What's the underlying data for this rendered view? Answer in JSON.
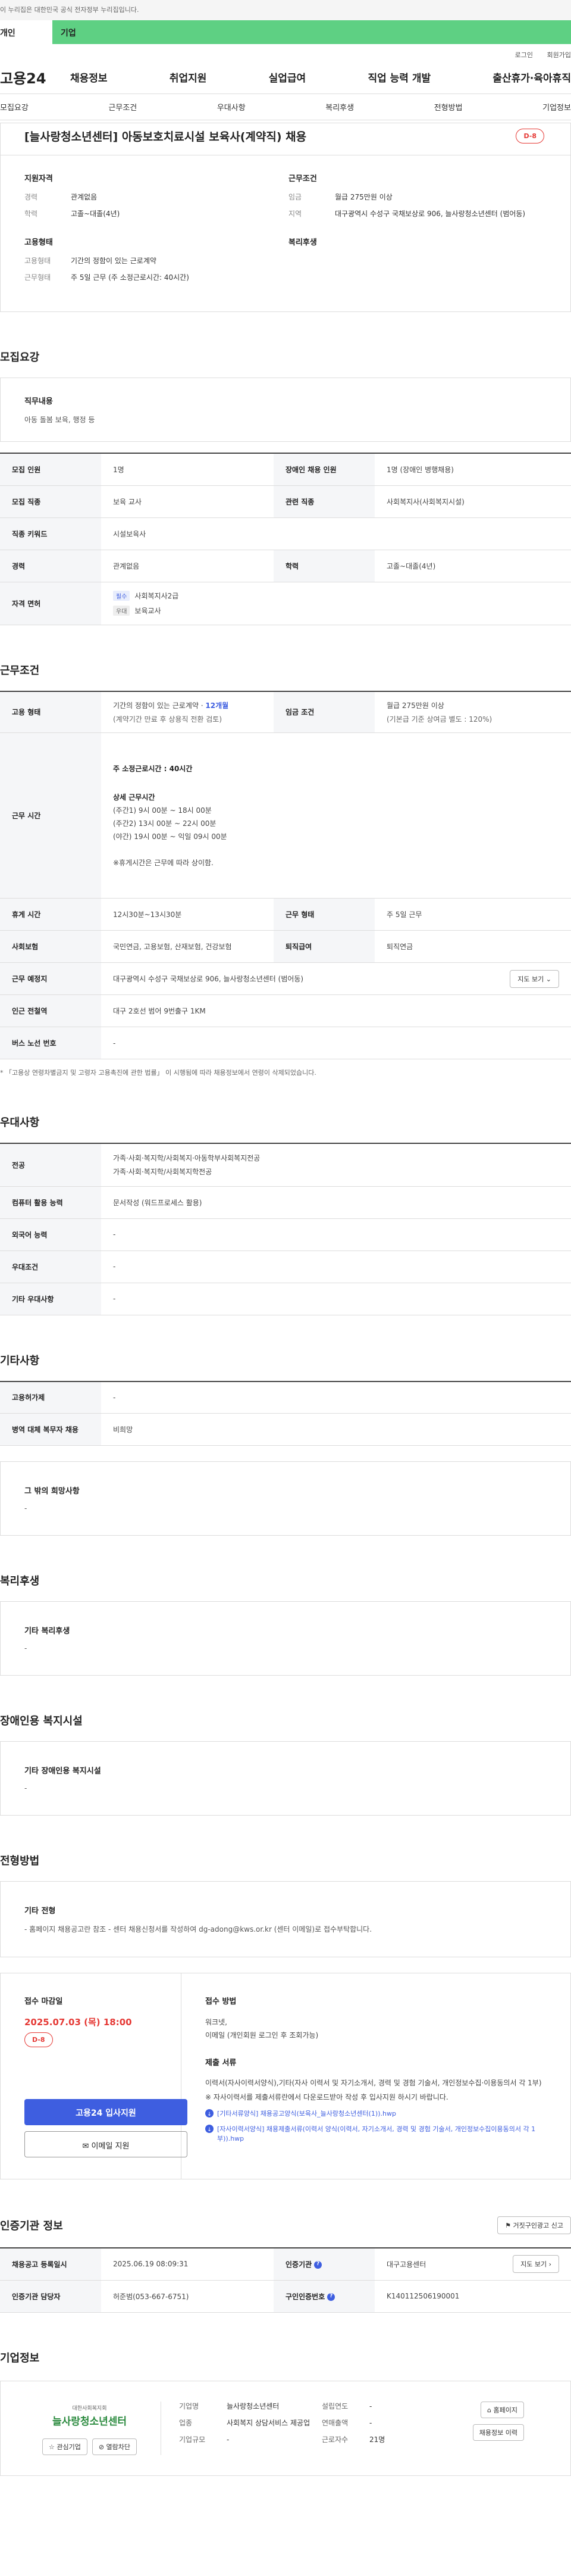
{
  "gov_banner": "이 누리집은 대한민국 공식 전자정부 누리집입니다.",
  "top_tabs": [
    "개인",
    "기업"
  ],
  "util": {
    "login": "로그인",
    "signup": "회원가입"
  },
  "gnb": {
    "logo": "고용24",
    "menu": [
      "채용정보",
      "취업지원",
      "실업급여",
      "직업 능력 개발",
      "출산휴가·육아휴직"
    ]
  },
  "anchor_nav": [
    "모집요강",
    "근무조건",
    "우대사항",
    "복리후생",
    "전형방법",
    "기업정보"
  ],
  "title_card": {
    "title": "[늘사랑청소년센터] 아동보호치료시설 보육사(계약직) 채용",
    "dday": "D-8",
    "req_heading": "지원자격",
    "req": [
      {
        "k": "경력",
        "v": "관계없음"
      },
      {
        "k": "학력",
        "v": "고졸~대졸(4년)"
      }
    ],
    "emp_heading": "고용형태",
    "emp": [
      {
        "k": "고용형태",
        "v": "기간의 정함이 있는 근로계약"
      },
      {
        "k": "근무형태",
        "v": "주 5일 근무 (주 소정근로시간: 40시간)"
      }
    ],
    "cond_heading": "근무조건",
    "cond": [
      {
        "k": "임금",
        "v": "월급 275만원 이상"
      },
      {
        "k": "지역",
        "v": "대구광역시 수성구 국채보상로 906, 늘사랑청소년센터 (범어동)"
      }
    ],
    "welfare_heading": "복리후생"
  },
  "recruit": {
    "heading": "모집요강",
    "duty_label": "직무내용",
    "duty_text": "아동 돌봄 보육, 행정 등",
    "rows": {
      "count_k": "모집 인원",
      "count_v": "1명",
      "disabled_k": "장애인 채용 인원",
      "disabled_v": "1명 (장애인 병행채용)",
      "job_k": "모집 직종",
      "job_v": "보육 교사",
      "related_k": "관련 직종",
      "related_v": "사회복지사(사회복지시설)",
      "keyword_k": "직종 키워드",
      "keyword_v": "시설보육사",
      "career_k": "경력",
      "career_v": "관계없음",
      "edu_k": "학력",
      "edu_v": "고졸~대졸(4년)",
      "license_k": "자격 면허",
      "license": [
        {
          "badge": "필수",
          "name": "사회복지사2급",
          "color": "#3e5ee0"
        },
        {
          "badge": "우대",
          "name": "보육교사",
          "color": "#888888"
        }
      ]
    }
  },
  "work": {
    "heading": "근무조건",
    "emp_k": "고용 형태",
    "emp_v1": "기간의 정함이 있는 근로계약 · ",
    "emp_v1_hl": "12개월",
    "emp_v2": "(계약기간 만료 후 상용직 전환 검토)",
    "wage_k": "임금 조건",
    "wage_v1": "월급 275만원 이상",
    "wage_v2": "(기본급 기준 상여금 별도 : 120%)",
    "time_k": "근무 시간",
    "time_main": "주 소정근로시간 : 40시간",
    "time_detail_h": "상세 근무시간",
    "time_lines": [
      "(주간1) 9시 00분 ~ 18시 00분",
      "(주간2) 13시 00분 ~ 22시 00분",
      "(야간) 19시 00분 ~ 익일 09시 00분"
    ],
    "time_note": "※휴게시간은 근무에 따라 상이함.",
    "break_k": "휴게 시간",
    "break_v": "12시30분~13시30분",
    "shape_k": "근무 형태",
    "shape_v": "주 5일 근무",
    "ins_k": "사회보험",
    "ins_v": "국민연금, 고용보험, 산재보험, 건강보험",
    "ret_k": "퇴직급여",
    "ret_v": "퇴직연금",
    "addr_k": "근무 예정지",
    "addr_v": "대구광역시 수성구 국채보상로 906, 늘사랑청소년센터 (범어동)",
    "map_btn": "지도 보기",
    "subway_k": "인근 전철역",
    "subway_v": "대구 2호선 범어 9번출구 1KM",
    "bus_k": "버스 노선 번호",
    "bus_v": "-",
    "note": "* 「고용상 연령차별금지 및 고령자 고용촉진에 관한 법률」 이 시행됨에 따라 채용정보에서 연령이 삭제되었습니다."
  },
  "pref": {
    "heading": "우대사항",
    "major_k": "전공",
    "major_v1": "가족·사회·복지학/사회복지·아동학부사회복지전공",
    "major_v2": "가족·사회·복지학/사회복지학전공",
    "pc_k": "컴퓨터 활용 능력",
    "pc_v": "문서작성 (워드프로세스 활용)",
    "lang_k": "외국어 능력",
    "lang_v": "-",
    "cond_k": "우대조건",
    "cond_v": "-",
    "etc_k": "기타 우대사항",
    "etc_v": "-"
  },
  "etc": {
    "heading": "기타사항",
    "emp_k": "고용허가제",
    "emp_v": "-",
    "mil_k": "병역 대체 복무자 채용",
    "mil_v": "비희망",
    "other_label": "그 밖의 희망사항",
    "other_v": "-"
  },
  "welfare": {
    "heading": "복리후생",
    "label": "기타 복리후생",
    "v": "-"
  },
  "facility": {
    "heading": "장애인용 복지시설",
    "label": "기타 장애인용 복지시설",
    "v": "-"
  },
  "selection": {
    "heading": "전형방법",
    "box_label": "기타 전형",
    "box_text": "- 홈페이지 채용공고란 참조 - 센터 채용신청서를 작성하여 dg-adong@kws.or.kr (센터 이메일)로 접수부탁합니다.",
    "deadline_label": "접수 마감일",
    "deadline": "2025.07.03 (목) 18:00",
    "dday": "D-8",
    "apply_btn": "고용24 입사지원",
    "email_btn": "이메일 지원",
    "method_label": "접수 방법",
    "method_lines": [
      "워크넷,",
      "이메일 (개인회원 로그인 후 조회가능)"
    ],
    "docs_label": "제출 서류",
    "docs_text": "이력서(자사이력서양식),기타(자사 이력서 및 자기소개서, 경력 및 경험 기술서, 개인정보수집·이용동의서 각 1부)",
    "docs_note": "※ 자사이력서를 제출서류란에서 다운로드받아 작성 후 입사지원 하시기 바랍니다.",
    "files": [
      "[기타서류양식] 채용공고양식(보육사_늘사랑청소년센터(1)).hwp",
      "[자사이력서양식] 채용제출서류(이력서 양식(이력서, 자기소개서, 경력 및 경험 기술서, 개인정보수집이용동의서 각 1부)).hwp"
    ]
  },
  "agency": {
    "heading": "인증기관 정보",
    "report_btn": "거짓구인광고 신고",
    "reg_k": "채용공고 등록일시",
    "reg_v": "2025.06.19 08:09:31",
    "org_k": "인증기관",
    "org_v": "대구고용센터",
    "manager_k": "인증기관 담당자",
    "manager_v": "허준범(053-667-6751)",
    "num_k": "구인인증번호",
    "num_v": "K140112506190001",
    "map_btn": "지도 보기"
  },
  "company": {
    "heading": "기업정보",
    "logo_small": "대한사회복지회",
    "logo_name": "늘사랑청소년센터",
    "fav_btn": "관심기업",
    "block_btn": "열람차단",
    "name_k": "기업명",
    "name_v": "늘사랑청소년센터",
    "biz_k": "업종",
    "biz_v": "사회복지 상담서비스 제공업",
    "size_k": "기업규모",
    "size_v": "-",
    "est_k": "설립연도",
    "est_v": "-",
    "sales_k": "연매출액",
    "sales_v": "-",
    "emp_k": "근로자수",
    "emp_v": "21명",
    "home_btn": "홈페이지",
    "list_btn": "채용정보 이력"
  }
}
